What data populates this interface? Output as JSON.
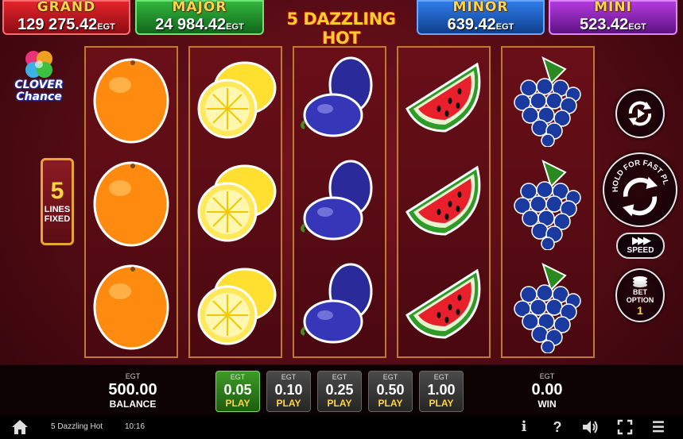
{
  "jackpots": {
    "grand": {
      "name": "GRAND",
      "value": "129 275.42",
      "unit": "EGT"
    },
    "major": {
      "name": "MAJOR",
      "value": "24 984.42",
      "unit": "EGT"
    },
    "minor": {
      "name": "MINOR",
      "value": "639.42",
      "unit": "EGT"
    },
    "mini": {
      "name": "MINI",
      "value": "523.42",
      "unit": "EGT"
    }
  },
  "game_logo": "5 DAZZLING HOT",
  "clover_logo": {
    "line1": "CLOVER",
    "line2": "Chance"
  },
  "lines": {
    "count": "5",
    "label1": "LINES",
    "label2": "FIXED"
  },
  "reels": [
    [
      "orange",
      "orange",
      "orange"
    ],
    [
      "lemon",
      "lemon",
      "lemon"
    ],
    [
      "plum",
      "plum",
      "plum"
    ],
    [
      "watermelon",
      "watermelon",
      "watermelon"
    ],
    [
      "grapes",
      "grapes",
      "grapes"
    ]
  ],
  "controls": {
    "autoplay_icon": "autoplay-icon",
    "spin_text": "HOLD FOR FAST PLAY",
    "speed_label": "SPEED",
    "bet_option_label1": "BET",
    "bet_option_label2": "OPTION",
    "bet_option_value": "1"
  },
  "balance": {
    "currency": "EGT",
    "value": "500.00",
    "label": "BALANCE"
  },
  "denominations": [
    {
      "currency": "EGT",
      "value": "0.05",
      "label": "PLAY",
      "active": true
    },
    {
      "currency": "EGT",
      "value": "0.10",
      "label": "PLAY",
      "active": false
    },
    {
      "currency": "EGT",
      "value": "0.25",
      "label": "PLAY",
      "active": false
    },
    {
      "currency": "EGT",
      "value": "0.50",
      "label": "PLAY",
      "active": false
    },
    {
      "currency": "EGT",
      "value": "1.00",
      "label": "PLAY",
      "active": false
    }
  ],
  "win": {
    "currency": "EGT",
    "value": "0.00",
    "label": "WIN"
  },
  "status_bar": {
    "title": "5 Dazzling Hot",
    "time": "10:16",
    "info": "i",
    "help": "?",
    "menu": "☰"
  },
  "colors": {
    "grand": "#e4232c",
    "major": "#33b53d",
    "minor": "#2f7ce8",
    "mini": "#b43ae0",
    "gold": "#ffd34a",
    "active_denom": "#3d9b26"
  }
}
